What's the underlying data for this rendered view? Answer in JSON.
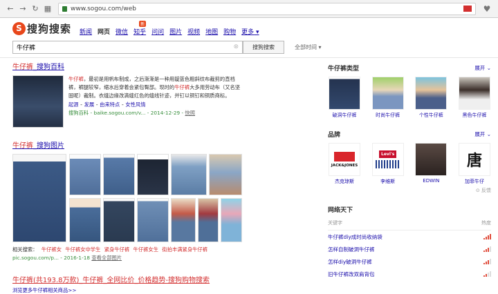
{
  "browser": {
    "url": "www.sogou.com/web"
  },
  "logo": {
    "text": "搜狗搜索"
  },
  "verticals": [
    {
      "label": "新闻"
    },
    {
      "label": "网页",
      "active": true
    },
    {
      "label": "微信"
    },
    {
      "label": "知乎",
      "badge": "新"
    },
    {
      "label": "问问"
    },
    {
      "label": "图片"
    },
    {
      "label": "视频"
    },
    {
      "label": "地图"
    },
    {
      "label": "购物"
    },
    {
      "label": "更多"
    }
  ],
  "search": {
    "query": "牛仔裤",
    "button": "搜狗搜索",
    "time_filter": "全部时间"
  },
  "results": {
    "r1": {
      "title_hl": "牛仔裤",
      "title_rest": "_搜狗百科",
      "desc_hl1": "牛仔裤",
      "desc_a": "，最初是用帆布制成，之后渐渐是一种用靛蓝色粗斜纹布裁剪的直裆裤，裤腿较窄，缩水后穿着会紧包臀部。现时的",
      "desc_hl2": "牛仔裤",
      "desc_b": "大多用劳动布（又名坚固呢）裁制。衣缝边缘改滴缝红色的缝线针迹，并钉以铜钉和铜质商标。",
      "sublinks": [
        "起源",
        "发展",
        "由来特点",
        "女性风情"
      ],
      "source": "搜狗百科 - baike.sogou.com/v...",
      "date": "- 2014-12-29 -",
      "snapshot": "快照"
    },
    "r2": {
      "title_hl": "牛仔裤",
      "title_rest": "_搜狗图片",
      "related_label": "相关搜索：",
      "related": [
        "牛仔裤女",
        "牛仔裤女中学生",
        "紧身牛仔裤",
        "牛仔裤女生",
        "街拍丰满紧身牛仔裤"
      ],
      "source": "pic.sogou.com/p...",
      "date": "- 2016-1-18",
      "view_all": "查看全部图片"
    },
    "r3": {
      "title": "牛仔裤(共193.8万款)_牛仔裤_全网比价_价格趋势-搜狗购物搜索",
      "sub": "浏览更多牛仔裤相关商品>>"
    }
  },
  "sidebar": {
    "types_title": "牛仔裤类型",
    "expand": "展开",
    "types": [
      "破洞牛仔裤",
      "时尚牛仔裤",
      "个性牛仔裤",
      "黑色牛仔裤"
    ],
    "brands_title": "品牌",
    "brands": [
      "杰克琼斯",
      "李维斯",
      "EDWIN",
      "加菲牛仔"
    ],
    "brand_logos": [
      "JACK&JONES",
      "Levi's",
      "EDWIN",
      "唐"
    ],
    "feedback": "反馈",
    "hot_title": "网络天下",
    "hot_col1": "关键字",
    "hot_col2": "热度",
    "hot_items": [
      {
        "label": "牛仔裤diy成时尚收纳袋",
        "heat": 4
      },
      {
        "label": "怎样自制破洞牛仔裤",
        "heat": 3
      },
      {
        "label": "怎样diy破洞牛仔裤",
        "heat": 3
      },
      {
        "label": "旧牛仔裤改双肩背包",
        "heat": 2
      }
    ]
  }
}
